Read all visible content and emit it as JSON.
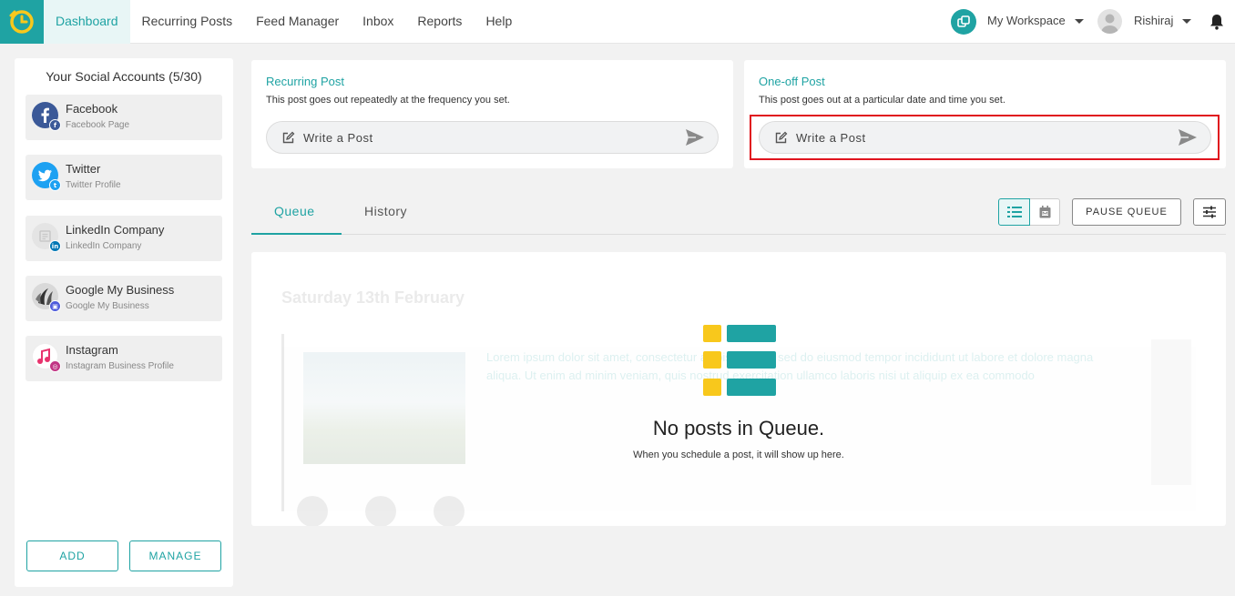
{
  "nav": {
    "items": [
      {
        "label": "Dashboard",
        "active": true
      },
      {
        "label": "Recurring Posts",
        "active": false
      },
      {
        "label": "Feed Manager",
        "active": false
      },
      {
        "label": "Inbox",
        "active": false
      },
      {
        "label": "Reports",
        "active": false
      },
      {
        "label": "Help",
        "active": false
      }
    ],
    "workspace_label": "My Workspace",
    "user_name": "Rishiraj"
  },
  "sidebar": {
    "title": "Your Social Accounts (5/30)",
    "accounts": [
      {
        "name": "Facebook",
        "type": "Facebook Page",
        "icon": "facebook-icon",
        "color": "#3b5998"
      },
      {
        "name": "Twitter",
        "type": "Twitter Profile",
        "icon": "twitter-icon",
        "color": "#1da1f2"
      },
      {
        "name": "LinkedIn Company",
        "type": "LinkedIn Company",
        "icon": "linkedin-icon",
        "color": "#0077b5"
      },
      {
        "name": "Google My Business",
        "type": "Google My Business",
        "icon": "google-business-icon",
        "color": "#4e5bdb"
      },
      {
        "name": "Instagram",
        "type": "Instagram Business Profile",
        "icon": "instagram-icon",
        "color": "#c13584"
      }
    ],
    "add_label": "ADD",
    "manage_label": "MANAGE"
  },
  "recurring_card": {
    "title": "Recurring Post",
    "description": "This post goes out repeatedly at the frequency you set.",
    "write_label": "Write a Post"
  },
  "oneoff_card": {
    "title": "One-off Post",
    "description": "This post goes out at a particular date and time you set.",
    "write_label": "Write a Post"
  },
  "queue": {
    "tabs": [
      {
        "label": "Queue",
        "active": true
      },
      {
        "label": "History",
        "active": false
      }
    ],
    "pause_label": "PAUSE QUEUE",
    "ghost_date": "Saturday 13th February",
    "ghost_text": "Lorem ipsum dolor sit amet, consectetur adipiscing elit, sed do eiusmod tempor incididunt ut labore et dolore magna aliqua. Ut enim ad minim veniam, quis nostrud exercitation ullamco laboris nisi ut aliquip ex ea commodo",
    "empty_title": "No posts in Queue.",
    "empty_subtitle": "When you schedule a post, it will show up here."
  },
  "colors": {
    "accent": "#1fa3a3",
    "highlight": "#e0141e",
    "empty_yellow": "#f8c81c"
  }
}
